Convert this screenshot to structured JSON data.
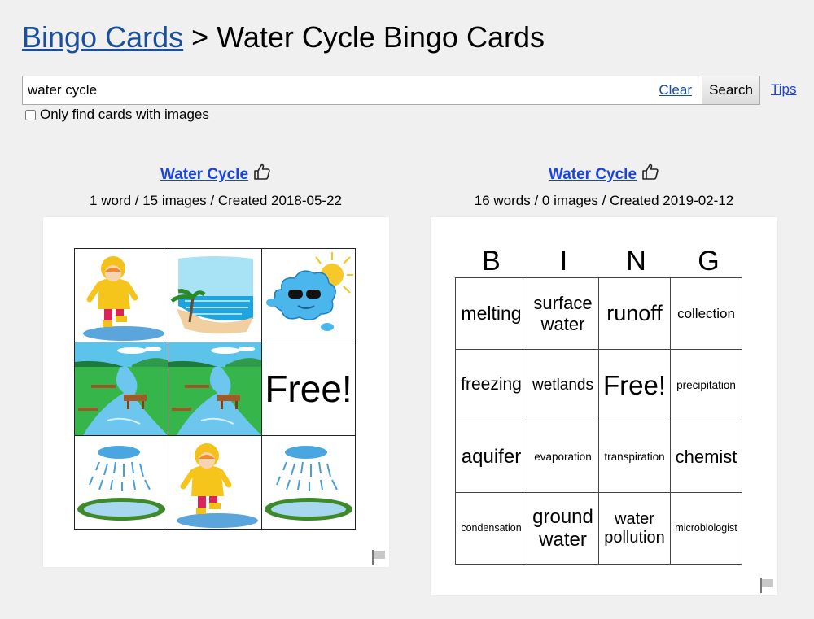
{
  "breadcrumb": {
    "parent": "Bingo Cards",
    "separator": ">",
    "current": "Water Cycle Bingo Cards"
  },
  "search": {
    "value": "water cycle",
    "clear_label": "Clear",
    "button_label": "Search",
    "tips_label": "Tips",
    "only_images_label": "Only find cards with images",
    "only_images_checked": false
  },
  "results": [
    {
      "title": "Water Cycle",
      "like_icon": "thumbs-up-icon",
      "meta": "1 word / 15 images / Created 2018-05-22",
      "card_type": "images",
      "cells": [
        {
          "image": "child-in-puddle"
        },
        {
          "image": "ocean-beach"
        },
        {
          "image": "cloud-with-sun"
        },
        {
          "image": "river-landscape"
        },
        {
          "image": "river-landscape"
        },
        {
          "text": "Free!"
        },
        {
          "image": "rain-on-pond"
        },
        {
          "image": "child-in-puddle"
        },
        {
          "image": "rain-on-pond"
        }
      ],
      "flag_icon": "flag-icon"
    },
    {
      "title": "Water Cycle",
      "like_icon": "thumbs-up-icon",
      "meta": "16 words / 0 images / Created 2019-02-12",
      "card_type": "words",
      "header": [
        "B",
        "I",
        "N",
        "G"
      ],
      "rows": [
        [
          "melting",
          "surface water",
          "runoff",
          "collection"
        ],
        [
          "freezing",
          "wetlands",
          "Free!",
          "precipitation"
        ],
        [
          "aquifer",
          "evaporation",
          "transpiration",
          "chemist"
        ],
        [
          "condensation",
          "ground water",
          "water pollution",
          "microbiologist"
        ]
      ],
      "flag_icon": "flag-icon"
    }
  ]
}
